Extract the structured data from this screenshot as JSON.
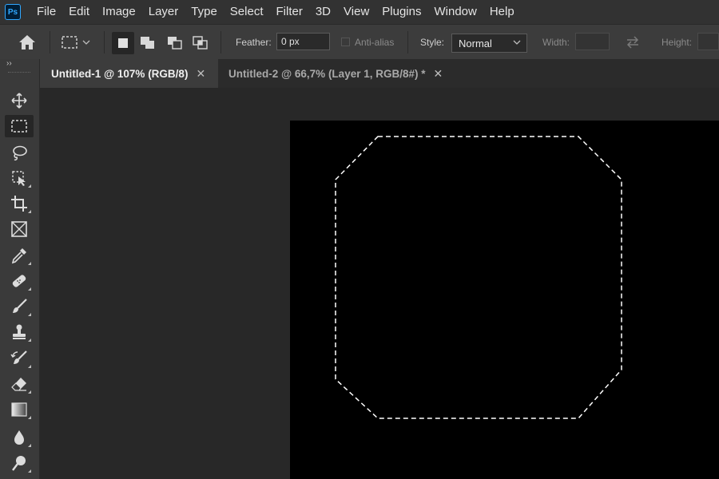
{
  "app": {
    "logo_text": "Ps"
  },
  "menu": [
    "File",
    "Edit",
    "Image",
    "Layer",
    "Type",
    "Select",
    "Filter",
    "3D",
    "View",
    "Plugins",
    "Window",
    "Help"
  ],
  "options": {
    "feather_label": "Feather:",
    "feather_value": "0 px",
    "antialias_label": "Anti-alias",
    "style_label": "Style:",
    "style_value": "Normal",
    "width_label": "Width:",
    "height_label": "Height:"
  },
  "tabs": [
    {
      "label": "Untitled-1 @ 107% (RGB/8)",
      "active": true
    },
    {
      "label": "Untitled-2 @ 66,7% (Layer 1, RGB/8#) *",
      "active": false
    }
  ],
  "tools": [
    "move",
    "rectangular-marquee",
    "lasso",
    "object-selection",
    "crop",
    "frame",
    "eyedropper",
    "spot-healing-brush",
    "brush",
    "clone-stamp",
    "history-brush",
    "eraser",
    "gradient",
    "blur",
    "dodge"
  ],
  "colors": {
    "menubar": "#323232",
    "optionsbar": "#3c3c3c",
    "toolbar": "#3a3a3a",
    "canvas": "#000000",
    "workspace": "#282828"
  }
}
